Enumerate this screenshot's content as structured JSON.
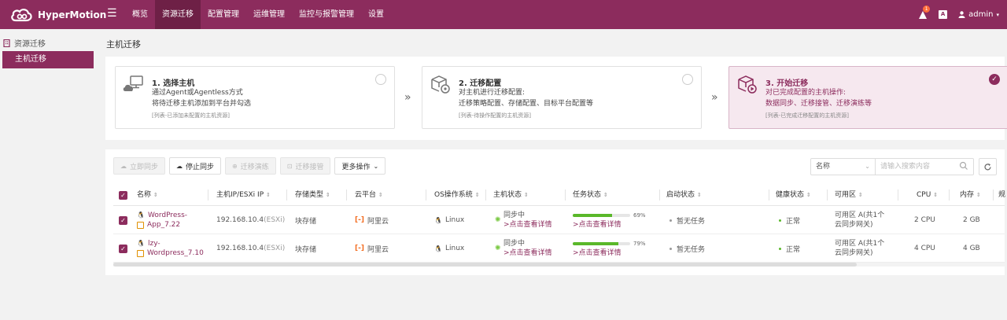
{
  "app": {
    "name": "HyperMotion"
  },
  "nav": {
    "items": [
      {
        "label": "概览",
        "active": false
      },
      {
        "label": "资源迁移",
        "active": true
      },
      {
        "label": "配置管理",
        "active": false
      },
      {
        "label": "运维管理",
        "active": false
      },
      {
        "label": "监控与报警管理",
        "active": false
      },
      {
        "label": "设置",
        "active": false
      }
    ],
    "notification_count": "1",
    "lang_icon": "A",
    "user": "admin"
  },
  "sidebar": {
    "section": "资源迁移",
    "items": [
      {
        "label": "主机迁移",
        "active": true
      }
    ]
  },
  "page": {
    "title": "主机迁移"
  },
  "steps": [
    {
      "title": "1. 选择主机",
      "desc1": "通过Agent或Agentless方式",
      "desc2": "将待迁移主机添加到平台并勾选",
      "note": "[列表-已添加未配置的主机资源]",
      "selected": false,
      "icon": "monitor-cloud-icon"
    },
    {
      "title": "2. 迁移配置",
      "desc1": "对主机进行迁移配置:",
      "desc2": "迁移策略配置、存储配置、目标平台配置等",
      "note": "[列表-待操作配置的主机资源]",
      "selected": false,
      "icon": "box-gear-icon"
    },
    {
      "title": "3. 开始迁移",
      "desc1": "对已完成配置的主机操作:",
      "desc2": "数据同步、迁移接管、迁移演练等",
      "note": "[列表-已完成迁移配置的主机资源]",
      "selected": true,
      "icon": "box-play-icon"
    }
  ],
  "toolbar": {
    "sync_now": "立即同步",
    "stop_sync": "停止同步",
    "drill": "迁移演练",
    "takeover": "迁移接管",
    "more": "更多操作"
  },
  "search": {
    "field": "名称",
    "placeholder": "请输入搜索内容"
  },
  "table": {
    "headers": {
      "name": "名称",
      "ip": "主机IP/ESXi IP",
      "storage": "存储类型",
      "cloud": "云平台",
      "os": "OS操作系统",
      "host_state": "主机状态",
      "task_state": "任务状态",
      "boot_state": "启动状态",
      "health": "健康状态",
      "az": "可用区",
      "cpu": "CPU",
      "mem": "内存",
      "extra": "规"
    },
    "rows": [
      {
        "name1": "WordPress-",
        "name2": "App_7.22",
        "ip": "192.168.10.4",
        "ip_suffix": "(ESXi)",
        "storage": "块存储",
        "cloud": "阿里云",
        "os": "Linux",
        "host_state": "同步中",
        "host_link": ">点击查看详情",
        "progress": 69,
        "progress_label": "69%",
        "task_link": ">点击查看详情",
        "boot_state": "暂无任务",
        "health": "正常",
        "az1": "可用区 A(共1个",
        "az2": "云同步网关)",
        "cpu": "2 CPU",
        "mem": "2 GB"
      },
      {
        "name1": "lzy-",
        "name2": "Wordpress_7.10",
        "ip": "192.168.10.4",
        "ip_suffix": "(ESXi)",
        "storage": "块存储",
        "cloud": "阿里云",
        "os": "Linux",
        "host_state": "同步中",
        "host_link": ">点击查看详情",
        "progress": 79,
        "progress_label": "79%",
        "task_link": ">点击查看详情",
        "boot_state": "暂无任务",
        "health": "正常",
        "az1": "可用区 A(共1个",
        "az2": "云同步网关)",
        "cpu": "4 CPU",
        "mem": "4 GB"
      }
    ]
  }
}
